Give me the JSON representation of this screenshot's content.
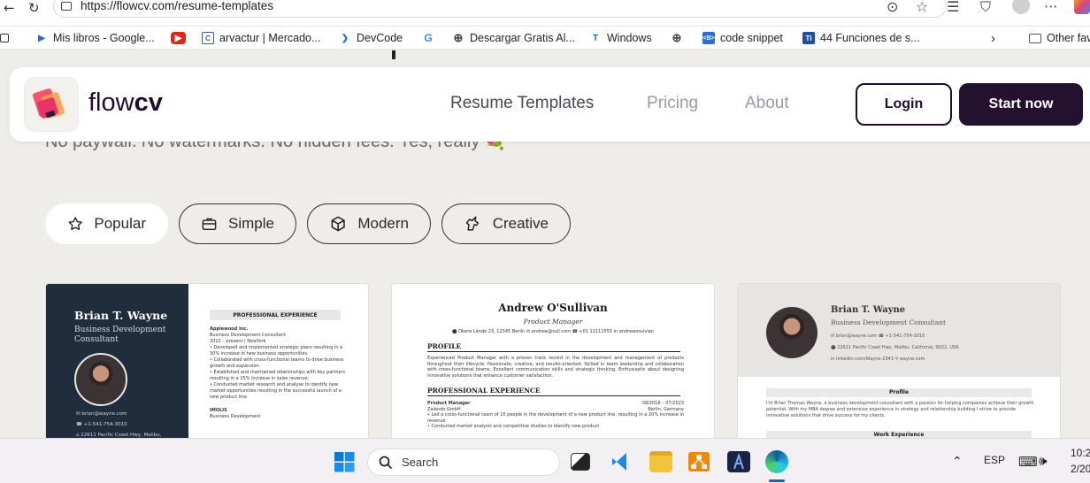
{
  "browser": {
    "url": "https://flowcv.com/resume-templates",
    "bookmarks": [
      {
        "label": "Mis libros - Google...",
        "icon": "play-books-icon",
        "color": "#2a66d9"
      },
      {
        "label": "",
        "icon": "youtube-icon",
        "color": "#e62117"
      },
      {
        "label": "arvactur | Mercado...",
        "icon": "mercado-icon",
        "color": "#3a56a8"
      },
      {
        "label": "DevCode",
        "icon": "devcode-icon",
        "color": "#2f6df0"
      },
      {
        "label": "",
        "icon": "google-icon",
        "color": "#4285f4"
      },
      {
        "label": "Descargar Gratis Al...",
        "icon": "globe-icon",
        "color": "#444444"
      },
      {
        "label": "Windows",
        "icon": "windows-t-icon",
        "color": "#1967d2"
      },
      {
        "label": "",
        "icon": "globe-icon",
        "color": "#444444"
      },
      {
        "label": "code snippet",
        "icon": "code-icon",
        "color": "#2b6cd8"
      },
      {
        "label": "44 Funciones de s...",
        "icon": "ti-icon",
        "color": "#1a4ea8"
      }
    ],
    "other_favorites": "Other fav"
  },
  "nav": {
    "logo_text_light": "flow",
    "logo_text_bold": "cv",
    "links": [
      "Resume Templates",
      "Pricing",
      "About"
    ],
    "login": "Login",
    "start": "Start now"
  },
  "hero": {
    "tagline": "No paywall. No watermarks. No hidden fees. Yes, really 💐"
  },
  "filters": [
    {
      "label": "Popular",
      "icon": "star-icon",
      "selected": true
    },
    {
      "label": "Simple",
      "icon": "briefcase-icon",
      "selected": false
    },
    {
      "label": "Modern",
      "icon": "cube-icon",
      "selected": false
    },
    {
      "label": "Creative",
      "icon": "unicorn-icon",
      "selected": false
    }
  ],
  "card1": {
    "name": "Brian T. Wayne",
    "role": "Business Development Consultant",
    "contacts": [
      "✉ brian@wayne.com",
      "☎ +1-541-754-3010",
      "⌂ 22611 Pacific Coast Hwy, Malibu,"
    ],
    "section": "PROFESSIONAL EXPERIENCE",
    "company": "Applewood Inc.",
    "position": "Business Development Consultant",
    "dates": "2022 – present | NewYork",
    "bullets": [
      "Developed and implemented strategic plans resulting in a 30% increase in new business opportunities.",
      "Collaborated with cross-functional teams to drive business growth and expansion.",
      "Established and maintained relationships with key partners resulting in a 25% increase in sales revenue.",
      "Conducted market research and analyse to identify new market opportunities resulting in the successful launch of a new product line."
    ],
    "company2": "IMOLIS",
    "position2": "Business Development"
  },
  "card2": {
    "name": "Andrew O'Sullivan",
    "role": "Product Manager",
    "contacts": "⬤ Obere Lände 23, 12345 Berlin   ✉ andrew@sull.com   ☎ +01 11111555   in andrewosulvian",
    "profile_h": "PROFILE",
    "profile": "Experienced Product Manager with a proven track record in the development and management of products throughout their lifecycle. Passionate, creative, and results-oriented. Skilled in team leadership and collaboration with cross-functional teams. Excellent communication skills and strategic thinking. Enthusiastic about designing innovative solutions that enhance customer satisfaction.",
    "exp_h": "PROFESSIONAL EXPERIENCE",
    "job_title": "Product Manager",
    "job_company": "Zalando GmbH",
    "job_dates": "08/2018 – 07/2023",
    "job_place": "Berlin, Germany",
    "bullets": [
      "Led a cross-functional team of 10 people in the development of a new product line, resulting in a 20% increase in revenue",
      "Conducted market analysis and competitive studies to identify new product"
    ]
  },
  "card3": {
    "name": "Brian T. Wayne",
    "role": "Business Development Consultant",
    "line1": "✉ brian@wayne.com      ☎ +1-541-754-3010",
    "line2": "⬤ 22611 Pacific Coast Hwy, Malibu, California, 9022, USA",
    "line3": "in linkedin.com/Wayne-2343      ⚲ wayne.com",
    "profile_h": "Profile",
    "profile": "I'm Brian Thomas Wayne, a business development consultant with a passion for helping companies achieve their growth potential. With my MBA degree and extensive experience in strategy and relationship building I strive to provide innovative solutions that drive success for my clients.",
    "next_h": "Work Experience"
  },
  "taskbar": {
    "search": "Search",
    "lang": "ESP",
    "time": "10:2",
    "date": "2/20"
  }
}
